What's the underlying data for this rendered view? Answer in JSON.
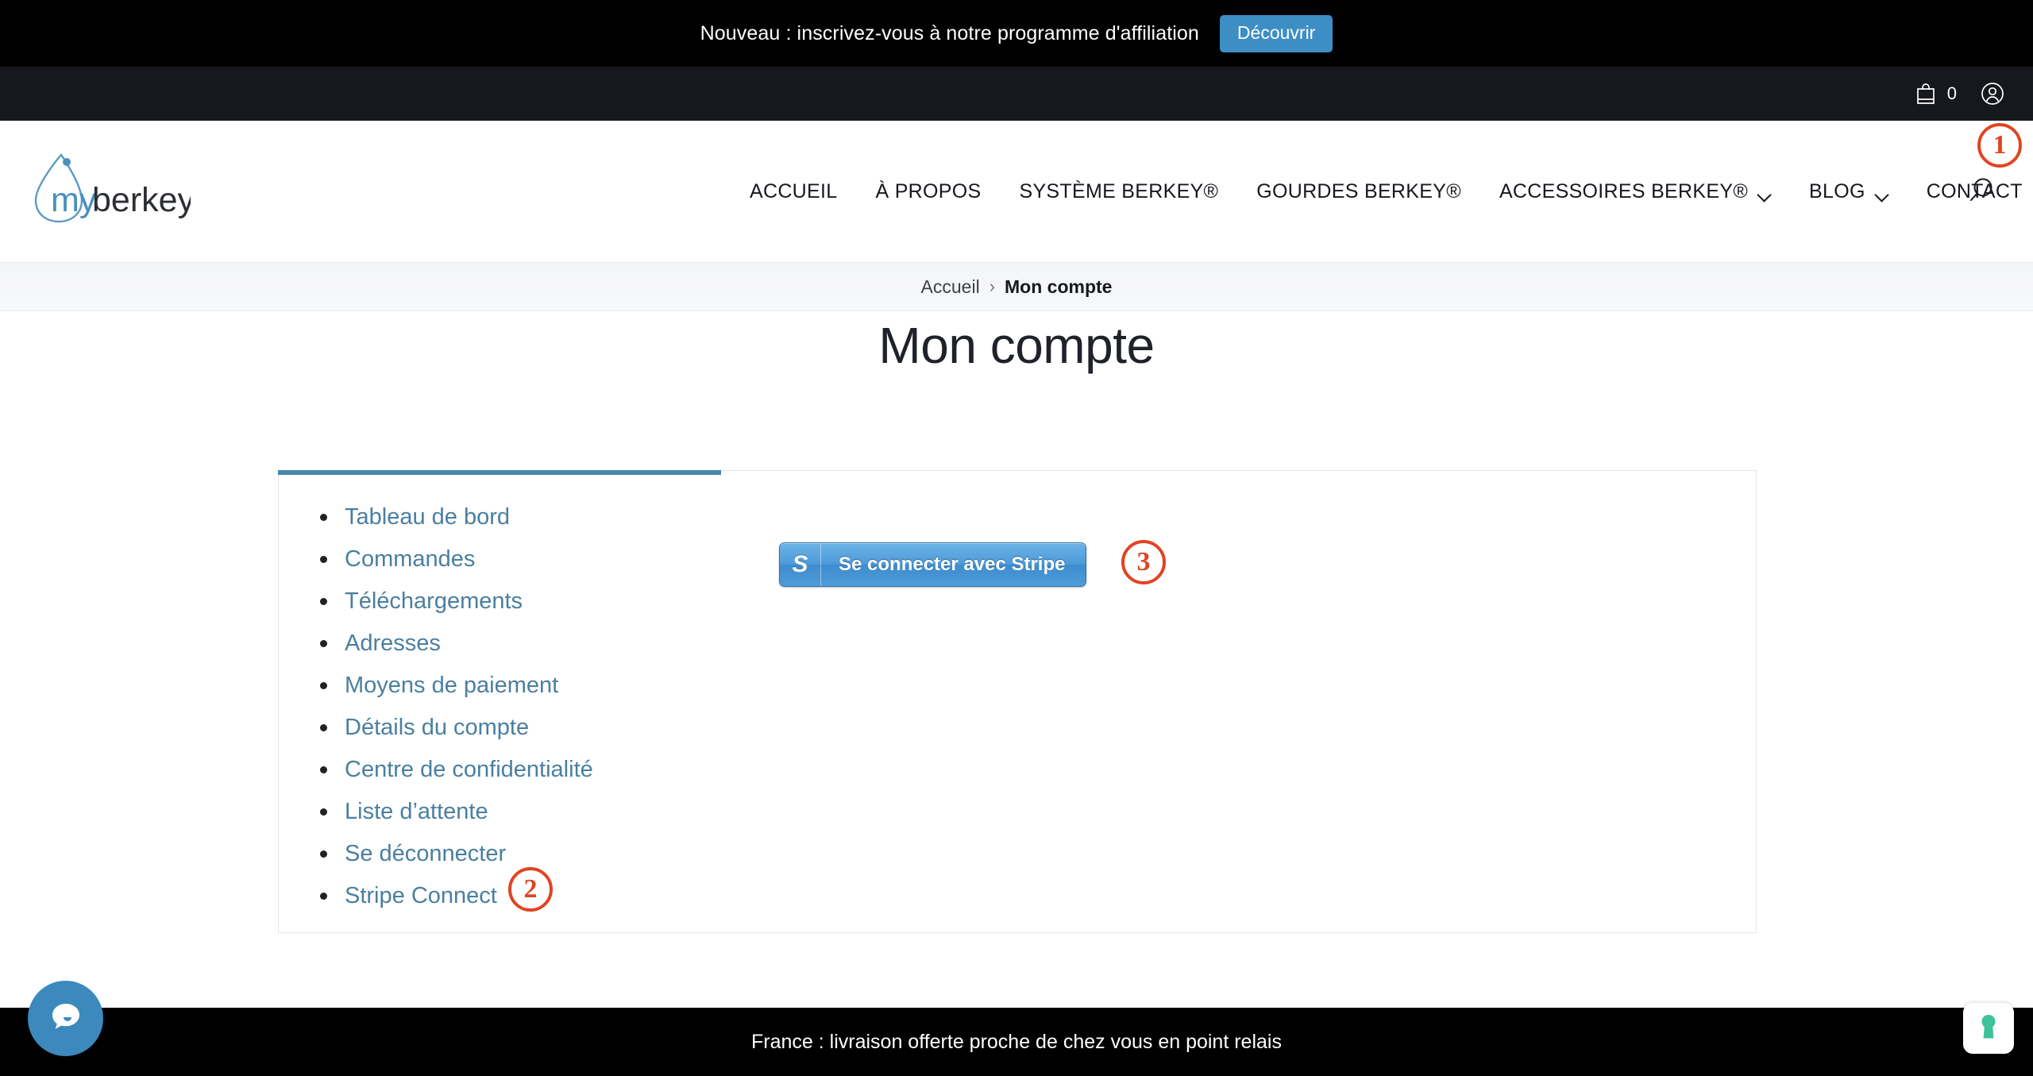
{
  "promo": {
    "text": "Nouveau : inscrivez-vous à notre programme d'affiliation",
    "button_label": "Découvrir",
    "button_color": "#3d8ec4"
  },
  "utility": {
    "cart_icon": "shopping-bag-icon",
    "cart_count": "0",
    "account_icon": "user-circle-icon"
  },
  "header": {
    "logo_text": "myberkey",
    "search_icon": "search-icon",
    "nav": [
      {
        "label": "ACCUEIL",
        "has_dropdown": false
      },
      {
        "label": "À PROPOS",
        "has_dropdown": false
      },
      {
        "label": "SYSTÈME BERKEY®",
        "has_dropdown": false
      },
      {
        "label": "GOURDES BERKEY®",
        "has_dropdown": false
      },
      {
        "label": "ACCESSOIRES BERKEY®",
        "has_dropdown": true
      },
      {
        "label": "BLOG",
        "has_dropdown": true
      },
      {
        "label": "CONTACT",
        "has_dropdown": false
      }
    ]
  },
  "breadcrumb": {
    "home": "Accueil",
    "separator": "›",
    "current": "Mon compte"
  },
  "page": {
    "title": "Mon compte"
  },
  "account": {
    "accent_color": "#4a87ad",
    "link_color": "#4a7fa0",
    "menu": [
      {
        "label": "Tableau de bord"
      },
      {
        "label": "Commandes"
      },
      {
        "label": "Téléchargements"
      },
      {
        "label": "Adresses"
      },
      {
        "label": "Moyens de paiement"
      },
      {
        "label": "Détails du compte"
      },
      {
        "label": "Centre de confidentialité"
      },
      {
        "label": "Liste d’attente"
      },
      {
        "label": "Se déconnecter"
      },
      {
        "label": "Stripe Connect"
      }
    ],
    "stripe_button": {
      "logo": "S",
      "label": "Se connecter avec Stripe"
    }
  },
  "annotations": {
    "color": "#e04423",
    "markers": [
      {
        "id": "1",
        "label": "1"
      },
      {
        "id": "2",
        "label": "2"
      },
      {
        "id": "3",
        "label": "3"
      }
    ]
  },
  "footer": {
    "text": "France : livraison offerte proche de chez vous en point relais"
  },
  "widgets": {
    "chat_icon": "chat-bubble-icon",
    "chat_color": "#3b89bd",
    "privacy_icon": "keyhole-icon",
    "privacy_color": "#3fc19a"
  }
}
